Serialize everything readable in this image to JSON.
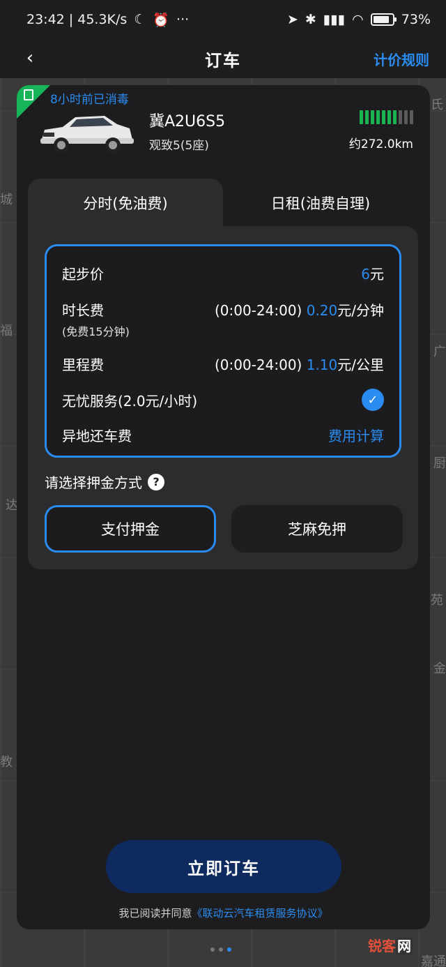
{
  "status_bar": {
    "time_speed": "23:42 | 45.3K/s",
    "more": "···",
    "battery": "73"
  },
  "nav": {
    "title": "订车",
    "right_link": "计价规则"
  },
  "vehicle": {
    "disinfect_notice": "8小时前已消毒",
    "plate": "冀A2U6S5",
    "model": "观致5(5座)",
    "range": "约272.0km",
    "fuel_level_fraction": 0.7
  },
  "tabs": [
    {
      "label": "分时(免油费)",
      "active": true
    },
    {
      "label": "日租(油费自理)",
      "active": false
    }
  ],
  "pricing": {
    "start_price_label": "起步价",
    "start_price_value": "6",
    "start_price_unit": "元",
    "duration_fee_label": "时长费",
    "duration_fee_note": "(免费15分钟)",
    "duration_fee_time": "(0:00-24:00)",
    "duration_fee_value": "0.20",
    "duration_fee_unit": "元/分钟",
    "mileage_fee_label": "里程费",
    "mileage_fee_time": "(0:00-24:00)",
    "mileage_fee_value": "1.10",
    "mileage_fee_unit": "元/公里",
    "worry_free_label": "无忧服务(2.0元/小时)",
    "worry_free_checked": true,
    "remote_return_label": "异地还车费",
    "remote_return_link": "费用计算"
  },
  "deposit": {
    "label": "请选择押金方式",
    "help": "?",
    "options": [
      "支付押金",
      "芝麻免押"
    ],
    "selected": "支付押金"
  },
  "actions": {
    "book_now": "立即订车"
  },
  "agreement": {
    "prefix": "我已阅读并同意",
    "link": "《联动云汽车租赁服务协议》"
  },
  "map_labels": [
    "城",
    "福",
    "达",
    "教",
    "氏",
    "广",
    "厨",
    "苑",
    "金",
    "嘉通"
  ],
  "watermark": {
    "part1": "锐客",
    "part2": "网"
  },
  "colors": {
    "accent": "#2a8cf0",
    "green": "#18b45a",
    "card": "#1d1d1f",
    "book_button": "#0e2a5e"
  }
}
